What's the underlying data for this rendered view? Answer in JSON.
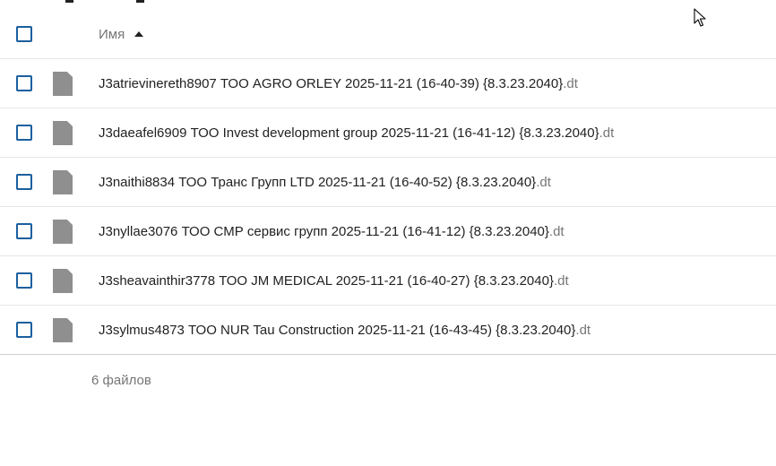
{
  "header": {
    "name_label": "Имя",
    "sort_icon": "caret-up-icon"
  },
  "files": [
    {
      "name": "J3atrievinereth8907 ТОО AGRO ORLEY 2025-11-21 (16-40-39) {8.3.23.2040}",
      "ext": ".dt"
    },
    {
      "name": "J3daeafel6909 ТОО Invest development group 2025-11-21 (16-41-12) {8.3.23.2040}",
      "ext": ".dt"
    },
    {
      "name": "J3naithi8834 ТОО Транс Групп LTD 2025-11-21 (16-40-52) {8.3.23.2040}",
      "ext": ".dt"
    },
    {
      "name": "J3nyllae3076 ТОО СМР сервис групп 2025-11-21 (16-41-12) {8.3.23.2040}",
      "ext": ".dt"
    },
    {
      "name": "J3sheavainthir3778 ТОО JM MEDICAL 2025-11-21 (16-40-27) {8.3.23.2040}",
      "ext": ".dt"
    },
    {
      "name": "J3sylmus4873 ТОО NUR Tau Construction 2025-11-21 (16-43-45) {8.3.23.2040}",
      "ext": ".dt"
    }
  ],
  "footer": {
    "count_label": "6 файлов"
  },
  "colors": {
    "checkbox_border": "#1b5f9e",
    "file_icon": "#8f8f8f",
    "muted_text": "#767676"
  }
}
